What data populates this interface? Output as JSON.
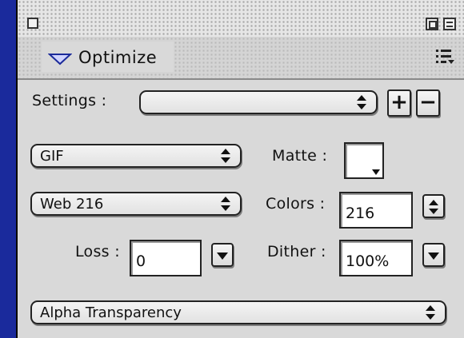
{
  "panel": {
    "title": "Optimize",
    "icons": [
      "close-box-icon",
      "zoom-box-icon",
      "collapse-box-icon",
      "disclosure-triangle-icon",
      "panel-menu-icon"
    ]
  },
  "settings": {
    "label": "Settings :",
    "value": "",
    "add_label": "+",
    "remove_label": "−"
  },
  "format": {
    "value": "GIF"
  },
  "matte": {
    "label": "Matte :",
    "color": "#ffffff"
  },
  "palette": {
    "value": "Web 216"
  },
  "colors": {
    "label": "Colors :",
    "value": "216"
  },
  "loss": {
    "label": "Loss :",
    "value": "0"
  },
  "dither": {
    "label": "Dither :",
    "value": "100%"
  },
  "transparency": {
    "value": "Alpha Transparency"
  },
  "theme": {
    "accent": "#1a2a9c",
    "panel_bg": "#d9d9d9"
  }
}
